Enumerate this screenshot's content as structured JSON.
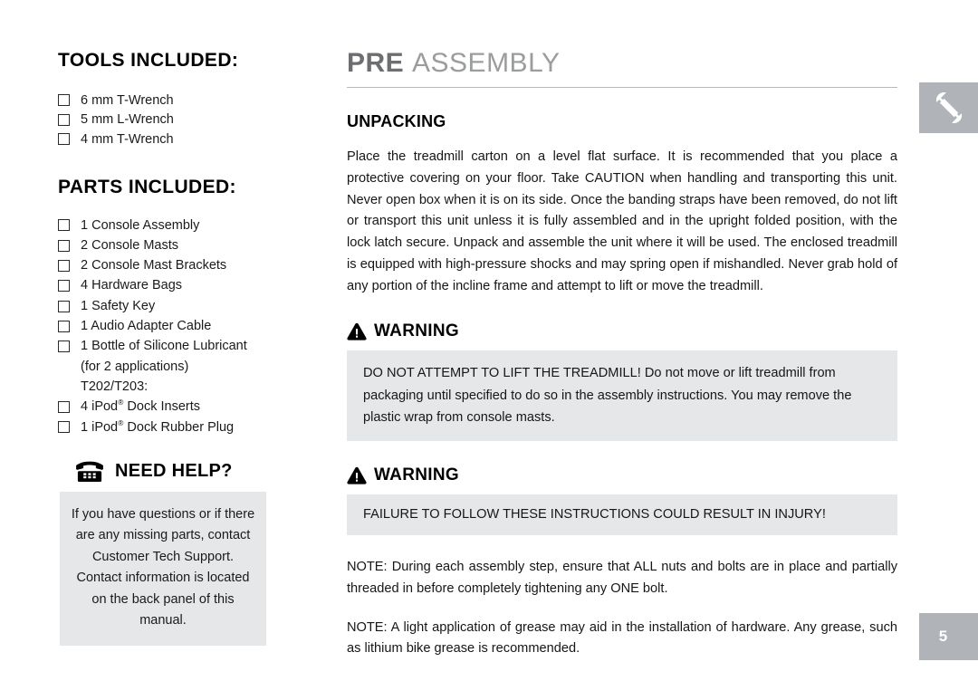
{
  "left": {
    "tools_title": "TOOLS INCLUDED:",
    "tools": [
      {
        "label": "6 mm T-Wrench"
      },
      {
        "label": "5 mm L-Wrench"
      },
      {
        "label": "4 mm T-Wrench"
      }
    ],
    "parts_title": "PARTS INCLUDED:",
    "parts": [
      {
        "label": "1 Console Assembly",
        "checkbox": true
      },
      {
        "label": "2 Console Masts",
        "checkbox": true
      },
      {
        "label": "2 Console Mast Brackets",
        "checkbox": true
      },
      {
        "label": "4 Hardware Bags",
        "checkbox": true
      },
      {
        "label": "1 Safety Key",
        "checkbox": true
      },
      {
        "label": "1 Audio Adapter Cable",
        "checkbox": true
      },
      {
        "label": "1 Bottle of Silicone Lubricant",
        "checkbox": true
      },
      {
        "label": "(for 2 applications)",
        "checkbox": false
      },
      {
        "label": "T202/T203:",
        "checkbox": false
      },
      {
        "label": "4 iPod® Dock Inserts",
        "checkbox": true
      },
      {
        "label": "1 iPod® Dock Rubber Plug",
        "checkbox": true
      }
    ],
    "need_help": {
      "icon": "telephone-icon",
      "title": "NEED HELP?",
      "body": "If you have questions or if there are any missing parts, contact Customer Tech Support. Contact information is located on the back panel of this manual."
    }
  },
  "main": {
    "heading_bold": "PRE",
    "heading_light": "ASSEMBLY",
    "unpacking_title": "UNPACKING",
    "unpacking_body": "Place the treadmill carton on a level flat surface. It is recommended that you place a protective covering on your floor. Take CAUTION when handling and transporting this unit. Never open box when it is on its side. Once the banding straps have been removed, do not lift or transport this unit unless it is fully assembled and in the upright folded position, with the lock latch secure. Unpack and assemble the unit where it will be used. The enclosed treadmill is equipped with high-pressure shocks and may spring open if mishandled. Never grab hold of any portion of the incline frame and attempt to lift or move the treadmill.",
    "warning_1": {
      "icon": "warning-triangle-icon",
      "title": "WARNING",
      "body": "DO NOT ATTEMPT TO LIFT THE TREADMILL! Do not move or lift treadmill from packaging until specified to do so in the assembly instructions. You may remove the plastic wrap from console masts."
    },
    "warning_2": {
      "icon": "warning-triangle-icon",
      "title": "WARNING",
      "body": "FAILURE TO FOLLOW THESE INSTRUCTIONS COULD RESULT IN INJURY!"
    },
    "note_1": "NOTE: During each assembly step, ensure that ALL nuts and bolts are in place and partially threaded in before completely tightening any ONE bolt.",
    "note_2": "NOTE: A light application of grease may aid in the installation of hardware. Any grease, such as lithium bike grease is recommended."
  },
  "tabs": {
    "wrench_icon": "wrench-icon",
    "page_number": "5"
  },
  "colors": {
    "tab_gray": "#b0b3b8",
    "box_gray": "#e6e7e8",
    "heading_bold_gray": "#6d6e71",
    "heading_light_gray": "#9b9c9e",
    "rule_gray": "#b8b9bb"
  }
}
